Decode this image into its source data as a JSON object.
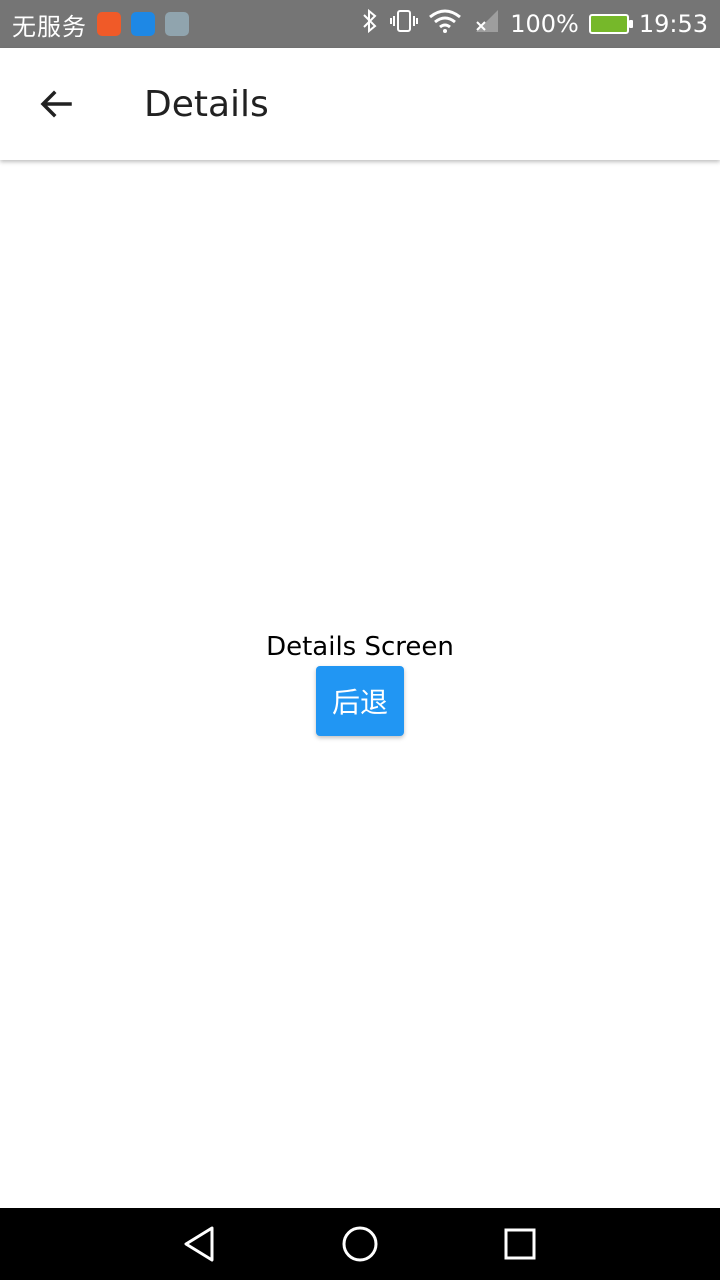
{
  "status_bar": {
    "carrier": "无服务",
    "battery_percent": "100%",
    "time": "19:53",
    "icons": [
      "app-icon",
      "usb-icon",
      "image-icon",
      "bluetooth-icon",
      "vibrate-icon",
      "wifi-icon",
      "no-signal-icon",
      "battery-charging-icon"
    ],
    "battery_color": "#76b82a",
    "background": "#757575"
  },
  "app_bar": {
    "back_icon": "arrow-back-icon",
    "title": "Details"
  },
  "content": {
    "label": "Details Screen",
    "button_label": "后退",
    "button_color": "#2196f3"
  },
  "nav_bar": {
    "buttons": [
      "back-triangle-icon",
      "home-circle-icon",
      "recents-square-icon"
    ]
  }
}
